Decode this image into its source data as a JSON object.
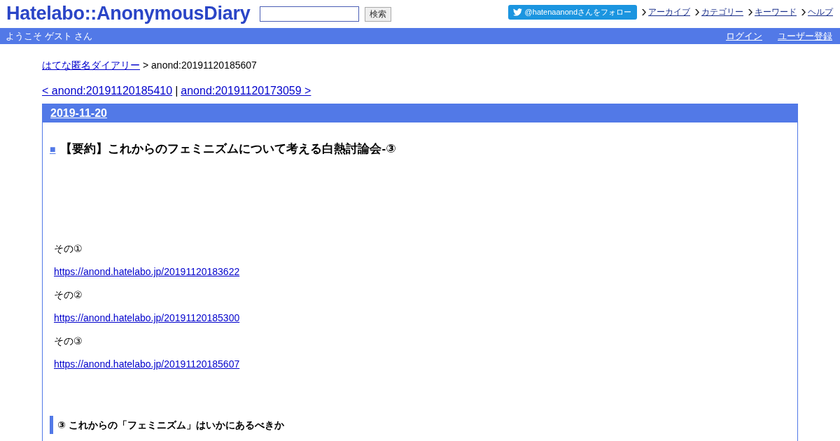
{
  "header": {
    "logo": "Hatelabo::AnonymousDiary",
    "search": {
      "button": "検索"
    },
    "follow_button": "@hatenaanondさんをフォロー",
    "nav": [
      "アーカイブ",
      "カテゴリー",
      "キーワード",
      "ヘルプ"
    ]
  },
  "user_bar": {
    "welcome": "ようこそ ゲスト さん",
    "links": [
      "ログイン",
      "ユーザー登録"
    ]
  },
  "breadcrumb": {
    "link": "はてな匿名ダイアリー",
    "current": "> anond:20191120185607"
  },
  "pager": {
    "prev": "< anond:20191120185410",
    "separator": "|",
    "next": "anond:20191120173059 >"
  },
  "entry": {
    "date": "2019-11-20",
    "bullet": "■",
    "title": "【要約】これからのフェミニズムについて考える白熱討論会-③",
    "body": [
      {
        "kind": "text",
        "text": "その①"
      },
      {
        "kind": "link",
        "text": "https://anond.hatelabo.jp/20191120183622"
      },
      {
        "kind": "text",
        "text": "その②"
      },
      {
        "kind": "link",
        "text": "https://anond.hatelabo.jp/20191120185300"
      },
      {
        "kind": "text",
        "text": "その③"
      },
      {
        "kind": "link",
        "text": "https://anond.hatelabo.jp/20191120185607"
      },
      {
        "kind": "heading",
        "text": "③ これからの「フェミニズム」はいかにあるべきか"
      }
    ]
  }
}
